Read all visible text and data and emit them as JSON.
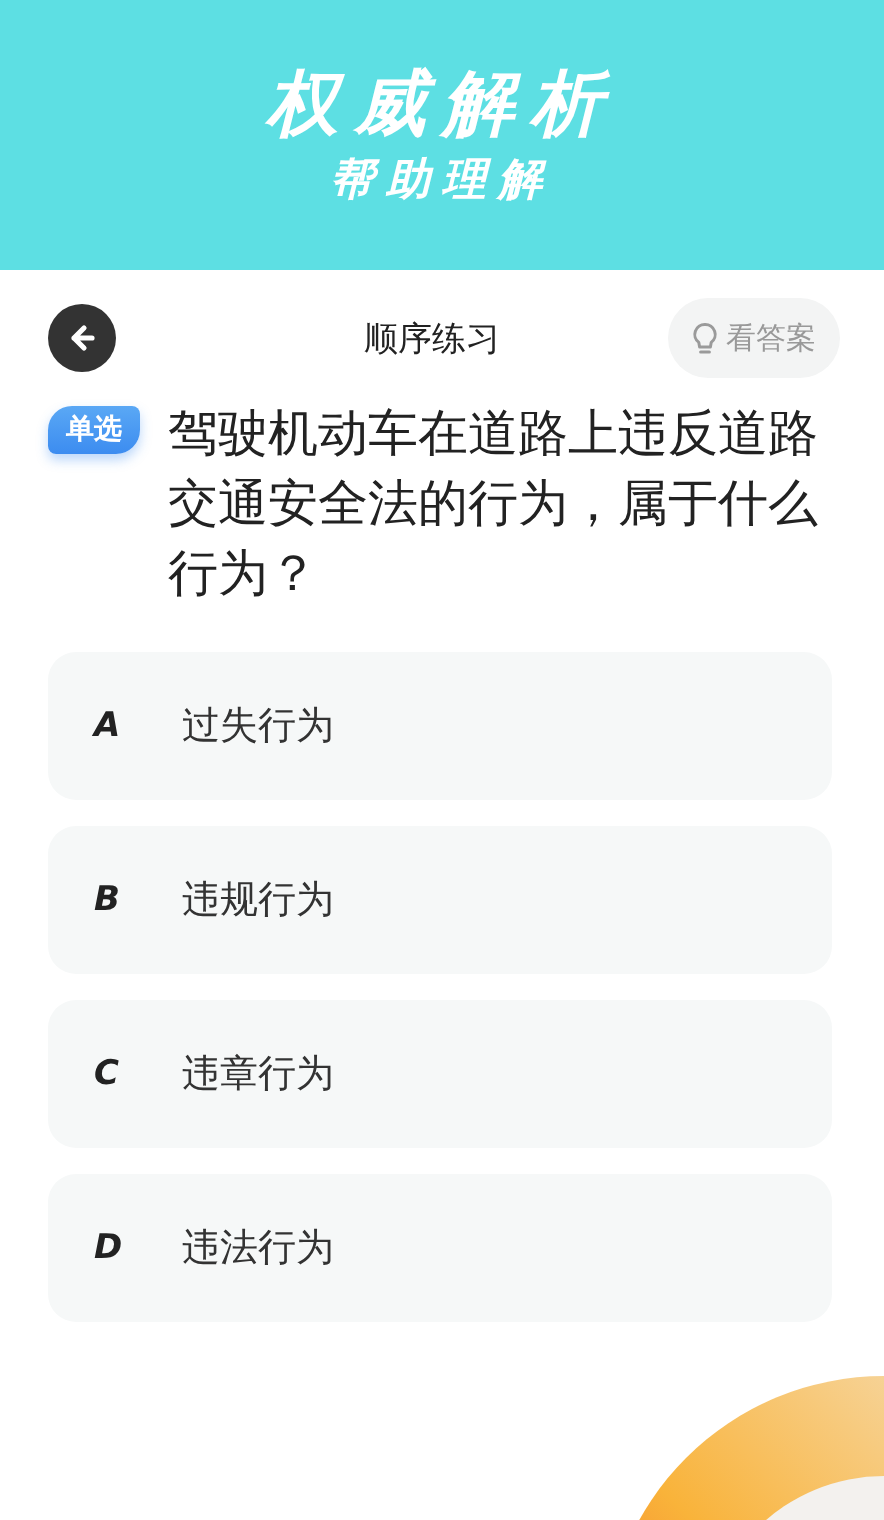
{
  "banner": {
    "title": "权威解析",
    "subtitle": "帮助理解"
  },
  "header": {
    "title": "顺序练习",
    "answer_button": "看答案"
  },
  "question": {
    "tag": "单选",
    "text": "驾驶机动车在道路上违反道路交通安全法的行为，属于什么行为？"
  },
  "options": [
    {
      "letter": "A",
      "text": "过失行为"
    },
    {
      "letter": "B",
      "text": "违规行为"
    },
    {
      "letter": "C",
      "text": "违章行为"
    },
    {
      "letter": "D",
      "text": "违法行为"
    }
  ]
}
